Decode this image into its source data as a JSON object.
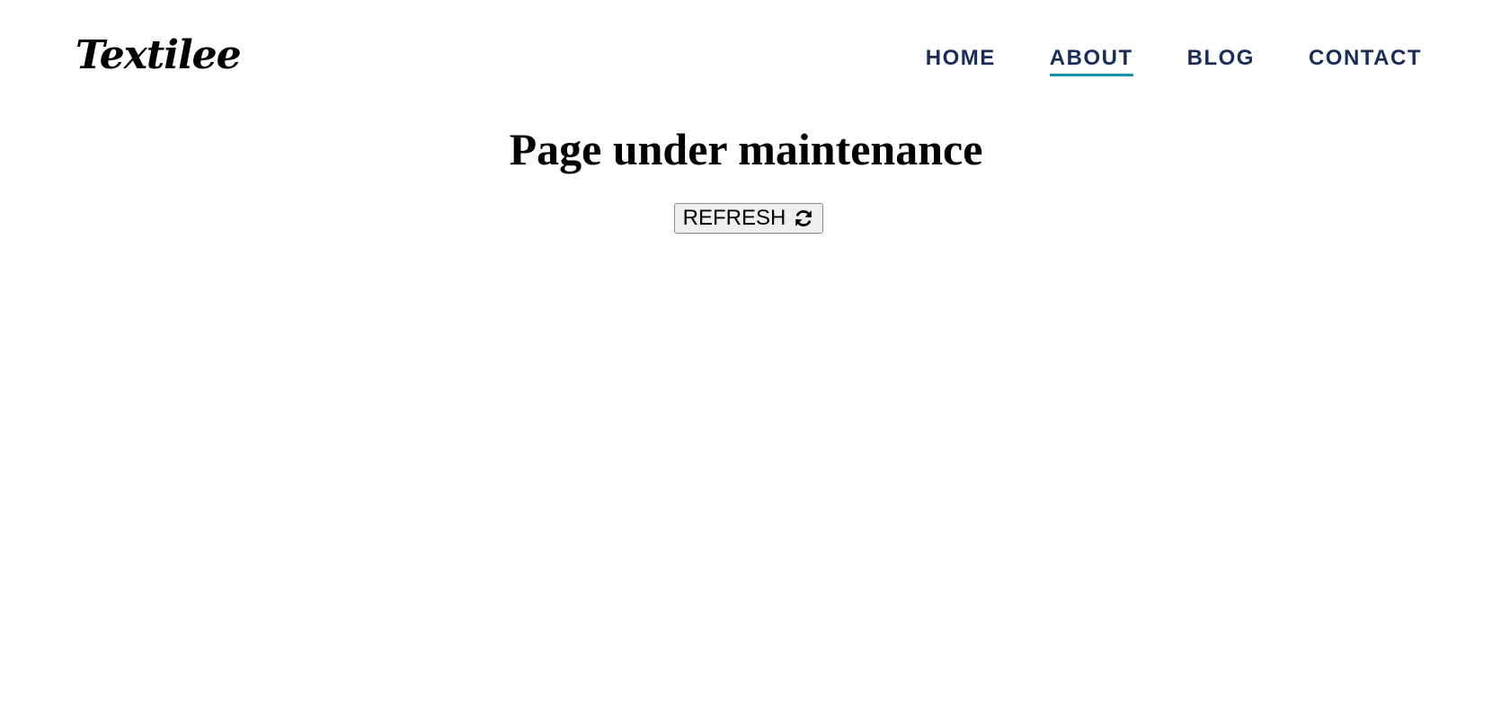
{
  "header": {
    "logo_text": "Textilee",
    "nav": [
      {
        "label": "HOME",
        "active": false
      },
      {
        "label": "ABOUT",
        "active": true
      },
      {
        "label": "BLOG",
        "active": false
      },
      {
        "label": "CONTACT",
        "active": false
      }
    ]
  },
  "main": {
    "title": "Page under maintenance",
    "refresh_button": {
      "label": "REFRESH",
      "icon": "refresh-icon"
    }
  },
  "colors": {
    "nav_text": "#1a2d5a",
    "nav_active_underline": "#1b8fb0",
    "button_bg": "#efeff1",
    "button_border": "#8a8a92"
  }
}
